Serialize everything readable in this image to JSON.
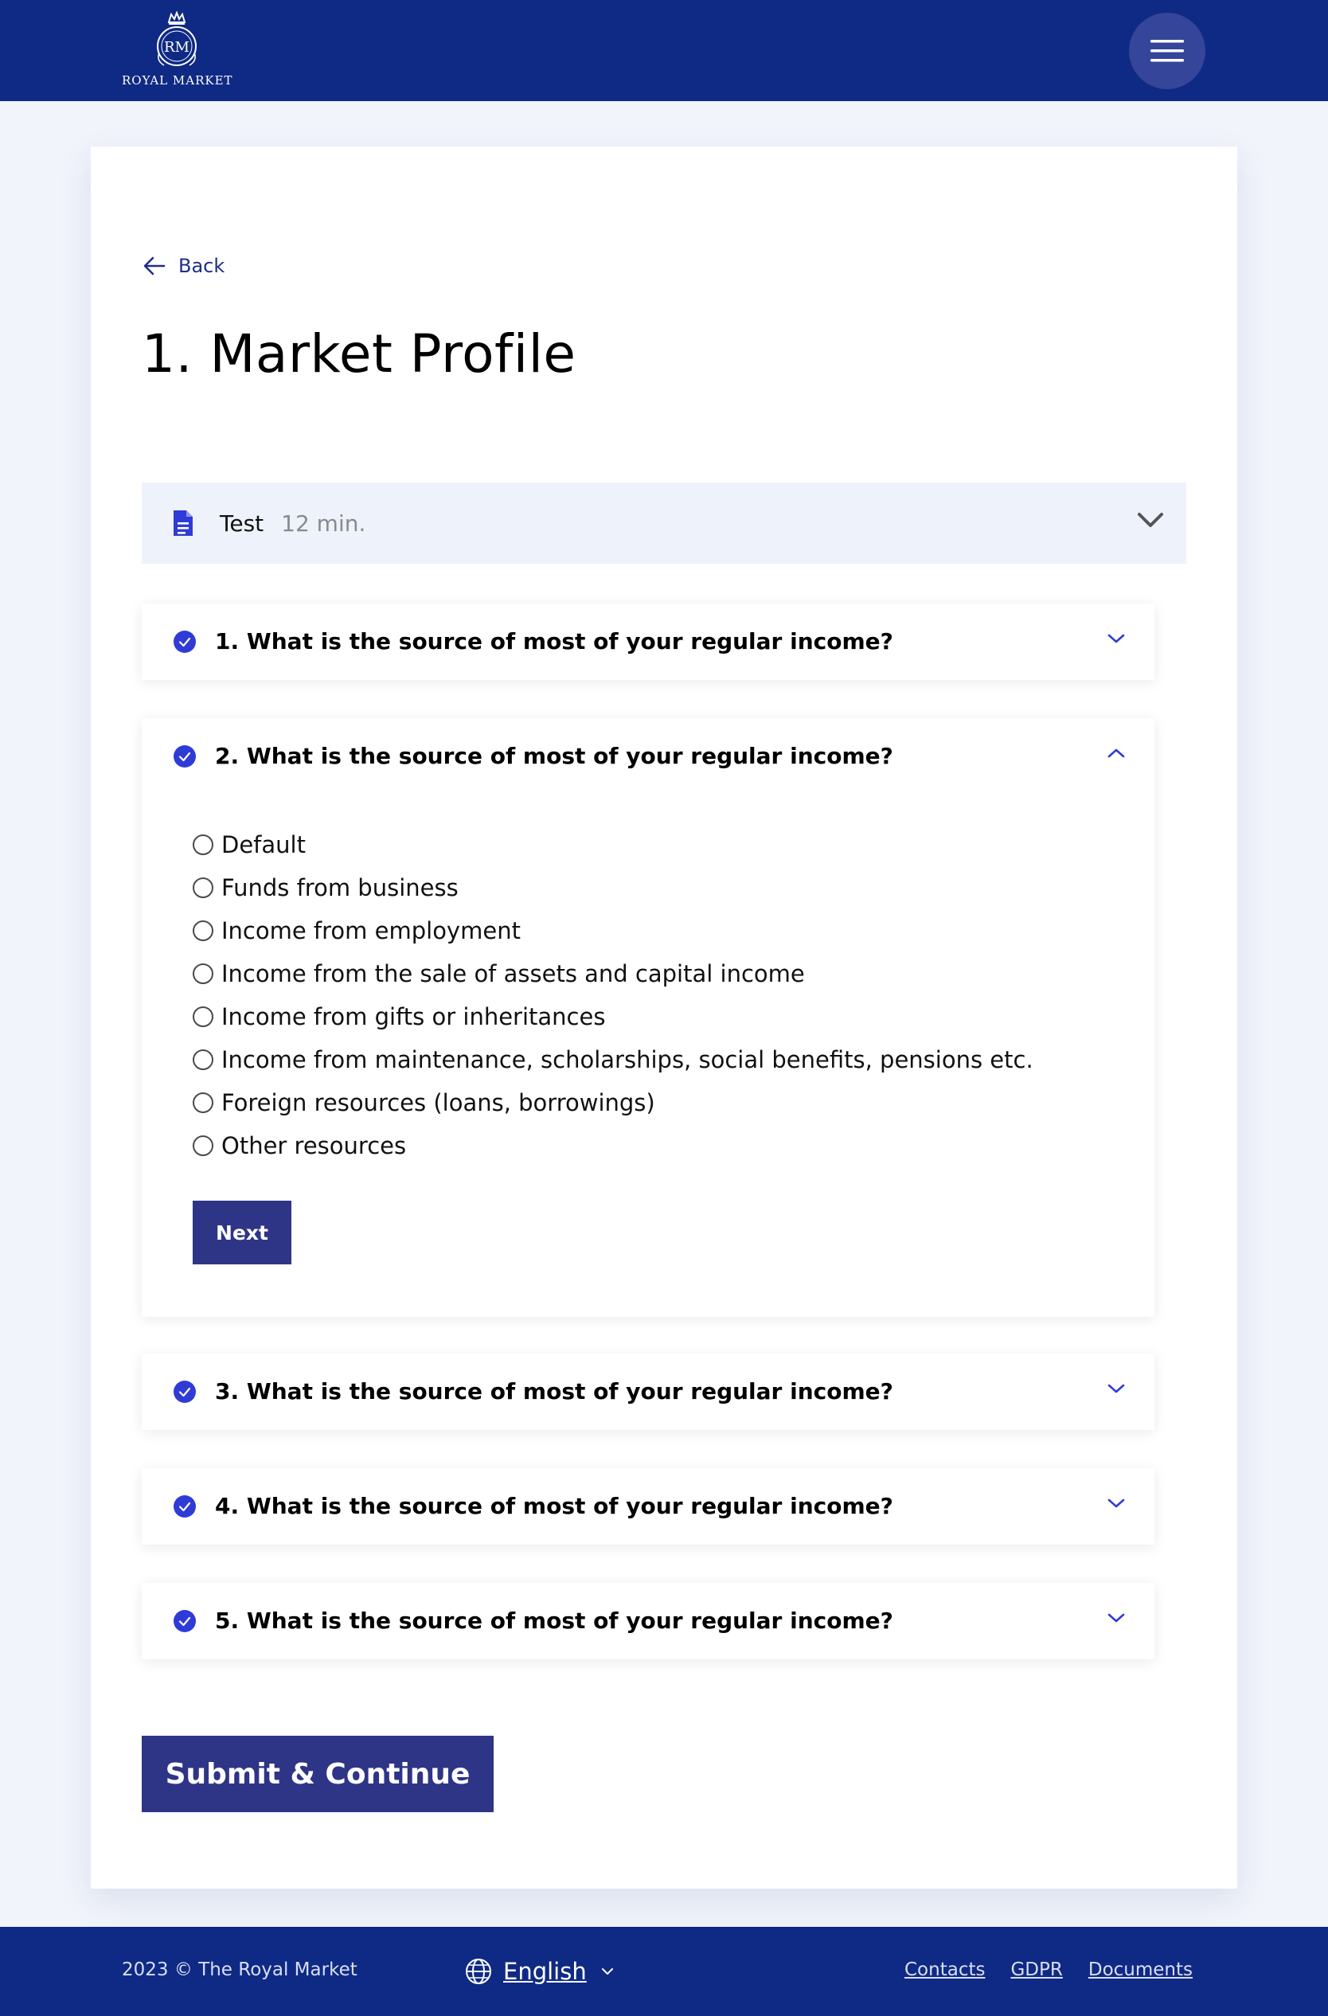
{
  "header": {
    "logo_monogram": "RM",
    "logo_text": "ROYAL MARKET",
    "menu_icon": "hamburger-icon"
  },
  "back_label": "Back",
  "page_title": "1. Market Profile",
  "test": {
    "name": "Test",
    "duration": "12 min.",
    "icon": "document-icon"
  },
  "questions": [
    {
      "title": "1. What is the source of most of your regular income?",
      "expanded": false
    },
    {
      "title": "2. What is the source of most of your regular income?",
      "expanded": true,
      "options": [
        "Default",
        "Funds from business",
        "Income from employment",
        "Income from the sale of assets and capital income",
        "Income from gifts or inheritances",
        "Income from maintenance, scholarships, social benefits, pensions etc.",
        "Foreign resources (loans, borrowings)",
        "Other resources"
      ],
      "next_label": "Next"
    },
    {
      "title": "3. What is the source of most of your regular income?",
      "expanded": false
    },
    {
      "title": "4. What is the source of most of your regular income?",
      "expanded": false
    },
    {
      "title": "5. What is the source of most of your regular income?",
      "expanded": false
    }
  ],
  "submit_label": "Submit & Continue",
  "footer": {
    "copyright": "2023 © The Royal Market",
    "language": "English",
    "links": [
      "Contacts",
      "GDPR",
      "Documents"
    ]
  },
  "colors": {
    "brand_navy": "#0f2a84",
    "button": "#2e3586",
    "accent_blue": "#2f3bd6",
    "panel_bg": "#eef2fb"
  }
}
